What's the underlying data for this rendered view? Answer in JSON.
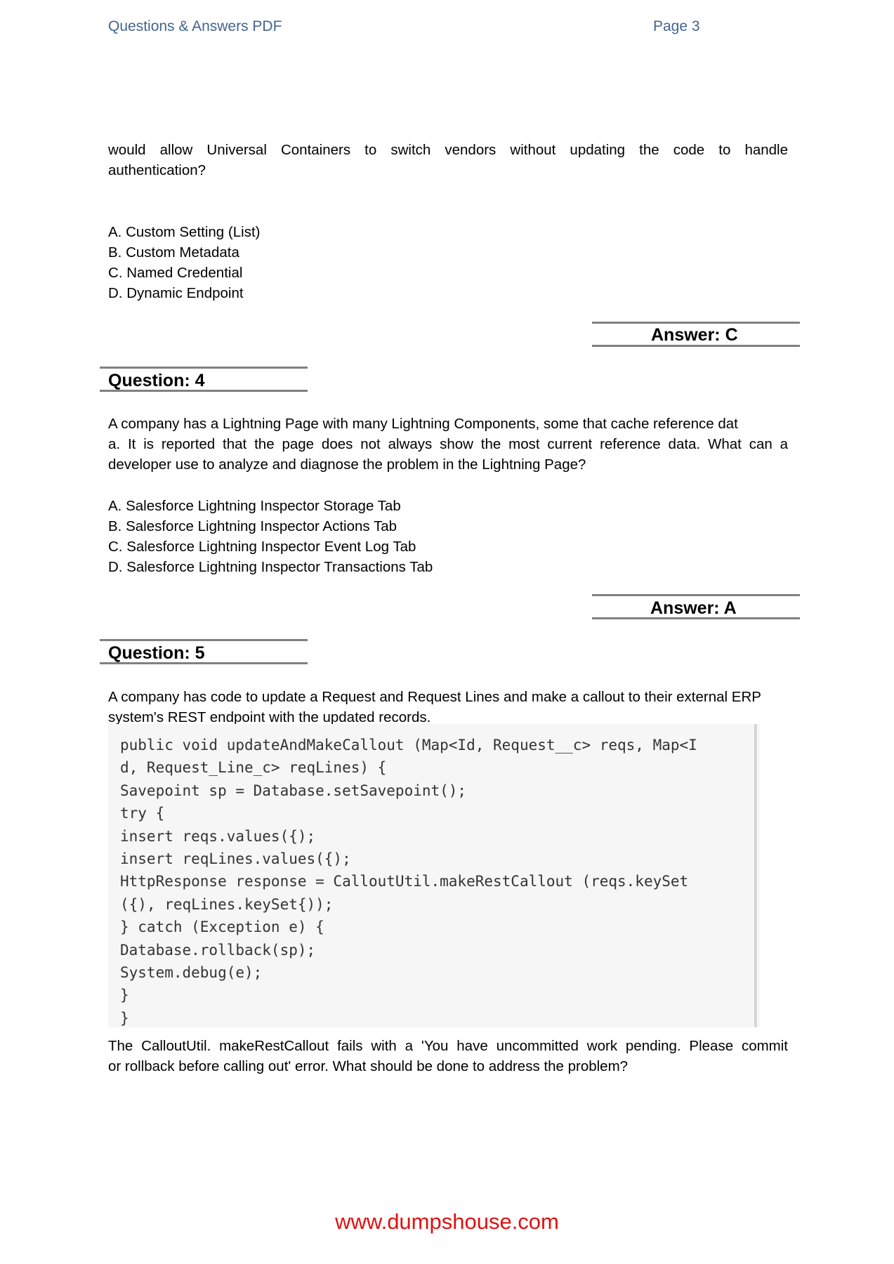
{
  "header": {
    "title": "Questions & Answers PDF",
    "page": "Page 3"
  },
  "q3_continued": {
    "text_lines": [
      "would allow Universal Containers to switch vendors without updating the code to handle",
      "authentication?"
    ],
    "options": [
      "A. Custom Setting (List)",
      "B. Custom Metadata",
      "C. Named Credential",
      "D. Dynamic Endpoint"
    ],
    "answer": "Answer: C"
  },
  "q4": {
    "title": "Question: 4",
    "text_lines": [
      "A company has a Lightning Page with many Lightning Components, some that cache reference dat",
      "a. It is reported that the page does not always show the most current reference data. What can a",
      "developer use to analyze and diagnose the problem in the Lightning Page?"
    ],
    "options": [
      "A. Salesforce Lightning Inspector Storage Tab",
      "B. Salesforce Lightning Inspector Actions Tab",
      "C. Salesforce Lightning Inspector Event Log Tab",
      "D. Salesforce Lightning Inspector Transactions Tab"
    ],
    "answer": "Answer: A"
  },
  "q5": {
    "title": "Question: 5",
    "text_lines": [
      "A company has code to update a Request and Request Lines and make a callout to their external ERP",
      "system's REST endpoint with the updated records."
    ],
    "code_lines": [
      "public void updateAndMakeCallout (Map<Id, Request__c> reqs, Map<I",
      "d, Request_Line_c> reqLines) {",
      "Savepoint sp = Database.setSavepoint();",
      "try {",
      "insert reqs.values({);",
      "insert reqLines.values({);",
      "HttpResponse response = CalloutUtil.makeRestCallout (reqs.keySet",
      "({), reqLines.keySet{));",
      "} catch (Exception e) {",
      "Database.rollback(sp);",
      "System.debug(e);",
      "}",
      "}"
    ],
    "after_lines": [
      "The CalloutUtil. makeRestCallout fails with a 'You have uncommitted work pending. Please commit",
      "or rollback before calling out' error. What should be done to address the problem?"
    ]
  },
  "footer": {
    "link": "www.dumpshouse.com"
  },
  "colors": {
    "header": "#44648f",
    "rule": "#808080",
    "footer_link": "#e01010",
    "code_bg": "#f6f6f6"
  }
}
